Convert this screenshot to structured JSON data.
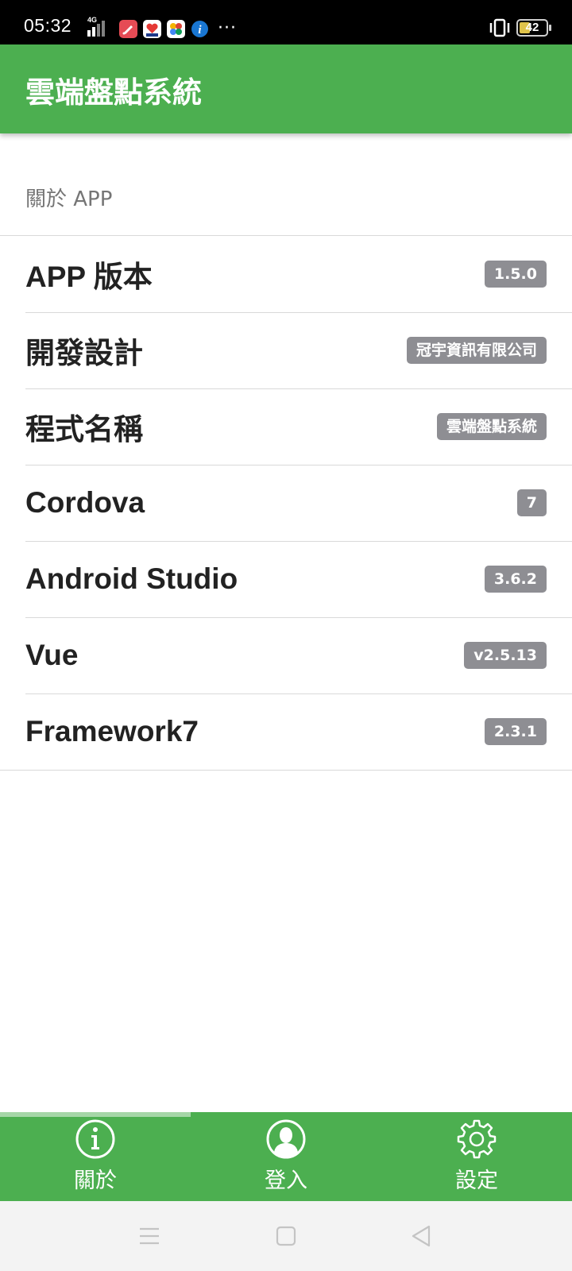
{
  "status_bar": {
    "time": "05:32",
    "network": "4G",
    "battery": "42",
    "battery_level": 0.42,
    "notification_icons": [
      "pen-app-icon",
      "health-app-icon",
      "photo-app-icon",
      "info-app-icon"
    ]
  },
  "app_bar": {
    "title": "雲端盤點系統"
  },
  "about_section": {
    "header": "關於 APP",
    "items": [
      {
        "label": "APP 版本",
        "value": "1.5.0"
      },
      {
        "label": "開發設計",
        "value": "冠宇資訊有限公司"
      },
      {
        "label": "程式名稱",
        "value": "雲端盤點系統"
      },
      {
        "label": "Cordova",
        "value": "7"
      },
      {
        "label": "Android Studio",
        "value": "3.6.2"
      },
      {
        "label": "Vue",
        "value": "v2.5.13"
      },
      {
        "label": "Framework7",
        "value": "2.3.1"
      }
    ]
  },
  "tab_bar": {
    "tabs": [
      {
        "label": "關於",
        "icon": "info-icon",
        "active": true
      },
      {
        "label": "登入",
        "icon": "user-icon",
        "active": false
      },
      {
        "label": "設定",
        "icon": "gear-icon",
        "active": false
      }
    ]
  },
  "colors": {
    "primary": "#4caf50",
    "badge": "#8e8e93",
    "tab_indicator": "#a5d6a7"
  },
  "nav_bar": {
    "buttons": [
      "menu-icon",
      "home-icon",
      "back-icon"
    ]
  }
}
